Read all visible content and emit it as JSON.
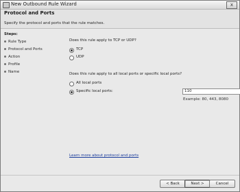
{
  "window": {
    "title": "New Outbound Rule Wizard",
    "close_label": "x"
  },
  "header": {
    "title": "Protocol and Ports",
    "description": "Specify the protocol and ports that the rule matches."
  },
  "steps": {
    "label": "Steps:",
    "items": [
      {
        "label": "Rule Type"
      },
      {
        "label": "Protocol and Ports"
      },
      {
        "label": "Action"
      },
      {
        "label": "Profile"
      },
      {
        "label": "Name"
      }
    ]
  },
  "protocol": {
    "question": "Does this rule apply to TCP or UDP?",
    "tcp_label": "TCP",
    "udp_label": "UDP",
    "selected": "TCP"
  },
  "ports": {
    "question": "Does this rule apply to all local ports or specific local ports?",
    "all_label": "All local ports",
    "specific_label": "Specific local ports:",
    "selected": "Specific local ports",
    "value": "110",
    "example": "Example: 80, 443, 8080"
  },
  "link": {
    "label": "Learn more about protocol and ports"
  },
  "buttons": {
    "back": "< Back",
    "next": "Next >",
    "cancel": "Cancel"
  }
}
